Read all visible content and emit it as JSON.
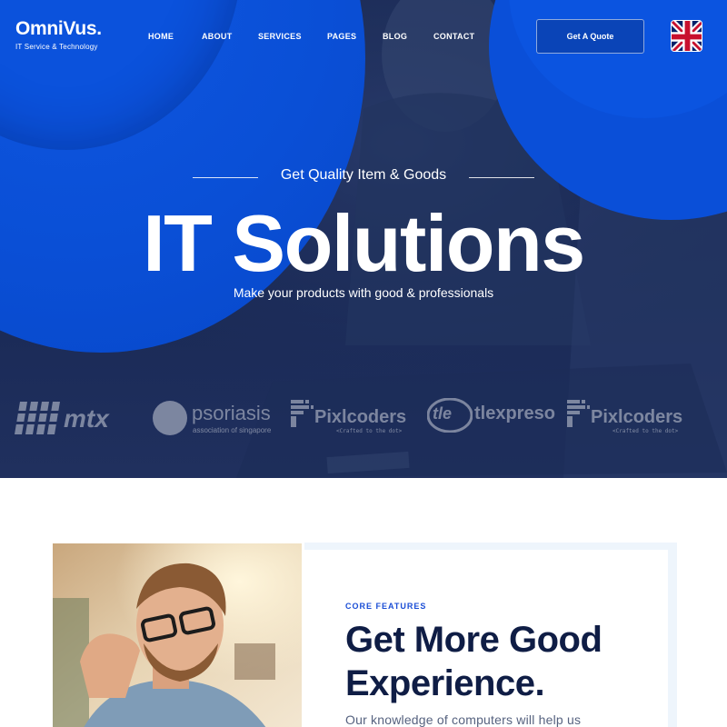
{
  "header": {
    "logo_title": "OmniVus.",
    "logo_subtitle": "IT Service & Technology",
    "nav": [
      {
        "label": "HOME"
      },
      {
        "label": "ABOUT"
      },
      {
        "label": "SERVICES"
      },
      {
        "label": "PAGES"
      },
      {
        "label": "BLOG"
      },
      {
        "label": "CONTACT"
      }
    ],
    "cta_label": "Get A Quote",
    "language_flag_icon": "uk-flag-icon"
  },
  "hero": {
    "eyebrow": "Get Quality Item & Goods",
    "title": "IT Solutions",
    "subtitle": "Make your products with good & professionals"
  },
  "partners": [
    {
      "name": "mtx",
      "icon": "mtx-logo"
    },
    {
      "name": "psoriasis",
      "tagline": "association of singapore",
      "icon": "psoriasis-logo"
    },
    {
      "name": "Pixlcoders",
      "tagline": "<Crafted to the dot>",
      "icon": "pixlcoders-logo"
    },
    {
      "name": "tlexpreso",
      "badge": "tle",
      "icon": "tlexpreso-logo"
    },
    {
      "name": "Pixlcoders",
      "tagline": "<Crafted to the dot>",
      "icon": "pixlcoders-logo"
    }
  ],
  "features": {
    "label": "CORE FEATURES",
    "title": "Get More Good Experience.",
    "text": "Our knowledge of computers will help us"
  },
  "colors": {
    "brand_blue": "#0a4fd6",
    "navy_overlay": "#1a2a55",
    "heading_navy": "#0f1d45",
    "accent_label": "#1b4ed6"
  }
}
